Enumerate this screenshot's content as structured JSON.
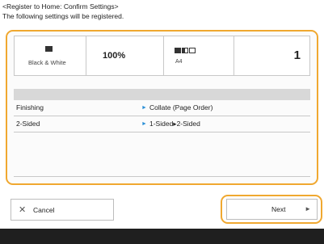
{
  "header": {
    "title_line1": "<Register to Home: Confirm Settings>",
    "title_line2": "The following settings will be registered."
  },
  "summary": {
    "color_mode": "Black & White",
    "ratio": "100%",
    "paper_size": "A4",
    "copies": "1"
  },
  "settings": [
    {
      "label": "Finishing",
      "value": "Collate (Page Order)"
    },
    {
      "label": "2-Sided",
      "value": "1-Sided▸2-Sided"
    }
  ],
  "buttons": {
    "cancel_label": "Cancel",
    "next_label": "Next"
  },
  "colors": {
    "accent": "#f0a830",
    "arrow": "#2a8fd6",
    "footer": "#1f1f1f"
  }
}
